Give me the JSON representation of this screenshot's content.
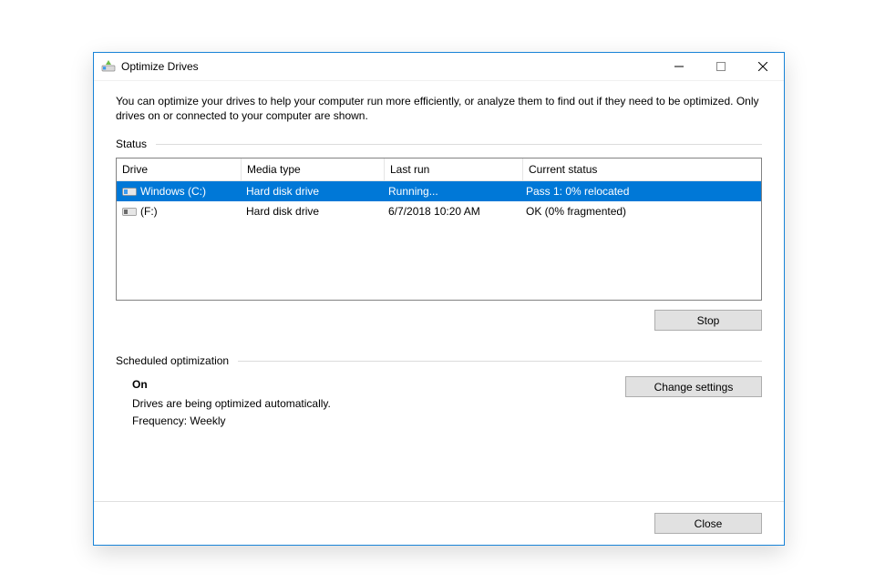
{
  "window": {
    "title": "Optimize Drives"
  },
  "intro": "You can optimize your drives to help your computer run more efficiently, or analyze them to find out if they need to be optimized. Only drives on or connected to your computer are shown.",
  "status_section_label": "Status",
  "columns": {
    "drive": "Drive",
    "media": "Media type",
    "last": "Last run",
    "status": "Current status"
  },
  "drives": [
    {
      "name": "Windows (C:)",
      "media": "Hard disk drive",
      "last": "Running...",
      "status": "Pass 1: 0% relocated",
      "selected": true,
      "icon_color": "#3a9bf0"
    },
    {
      "name": "(F:)",
      "media": "Hard disk drive",
      "last": "6/7/2018 10:20 AM",
      "status": "OK (0% fragmented)",
      "selected": false,
      "icon_color": "#6b6b6b"
    }
  ],
  "buttons": {
    "stop": "Stop",
    "change_settings": "Change settings",
    "close": "Close"
  },
  "scheduled": {
    "section_label": "Scheduled optimization",
    "state": "On",
    "desc": "Drives are being optimized automatically.",
    "frequency": "Frequency: Weekly"
  }
}
